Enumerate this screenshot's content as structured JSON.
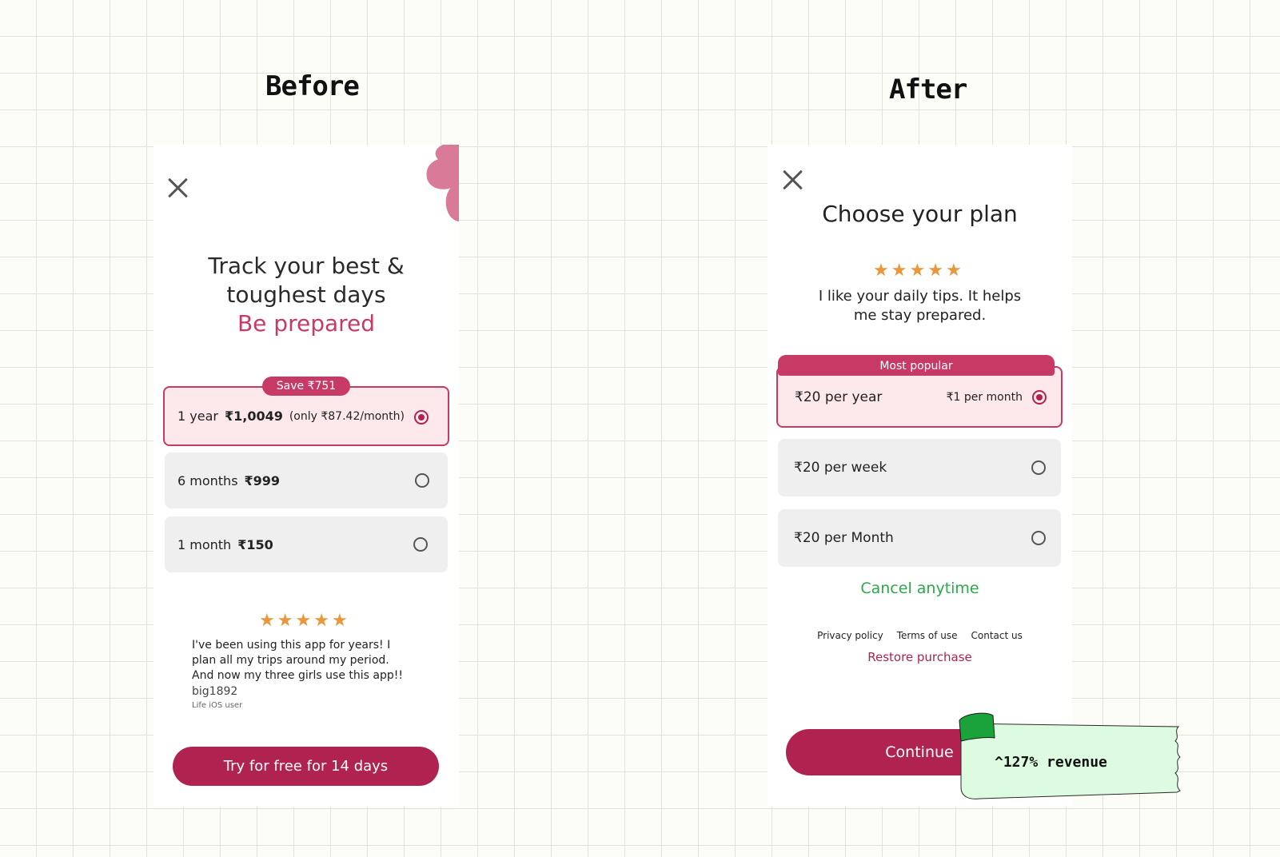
{
  "labels": {
    "before": "Before",
    "after": "After"
  },
  "before": {
    "headline_line1": "Track your best &",
    "headline_line2": "toughest days",
    "headline_accent": "Be prepared",
    "save_badge": "Save ₹751",
    "options": [
      {
        "duration": "1 year",
        "price": "₹1,0049",
        "note": "(only ₹87.42/month)",
        "selected": true
      },
      {
        "duration": "6 months",
        "price": "₹999",
        "note": "",
        "selected": false
      },
      {
        "duration": "1 month",
        "price": "₹150",
        "note": "",
        "selected": false
      }
    ],
    "rating": 5,
    "review_line1": "I've been using this app for years! I",
    "review_line2": "plan all my trips around my period.",
    "review_line3": "And now my three girls use this app!!",
    "reviewer": "big1892",
    "reviewer_meta": "Life iOS user",
    "cta": "Try for free for 14 days"
  },
  "after": {
    "title": "Choose your plan",
    "rating": 5,
    "testimonial_line1": "I like your daily tips. It helps",
    "testimonial_line2": "me stay prepared.",
    "popular_badge": "Most popular",
    "options": [
      {
        "price": "₹20 per year",
        "secondary": "₹1 per month",
        "selected": true
      },
      {
        "price": "₹20 per week",
        "secondary": "",
        "selected": false
      },
      {
        "price": "₹20 per Month",
        "secondary": "",
        "selected": false
      }
    ],
    "cancel_text": "Cancel anytime",
    "links": {
      "privacy": "Privacy policy",
      "terms": "Terms of use",
      "contact": "Contact us"
    },
    "restore": "Restore purchase",
    "cta": "Continue"
  },
  "sticky_note": "^127% revenue",
  "colors": {
    "accent": "#b0224f",
    "accent_pink": "#c73a66",
    "star": "#e9973a",
    "cancel_green": "#2aa84a",
    "note_green": "#dcfbe0",
    "note_tape": "#1aa33a"
  }
}
